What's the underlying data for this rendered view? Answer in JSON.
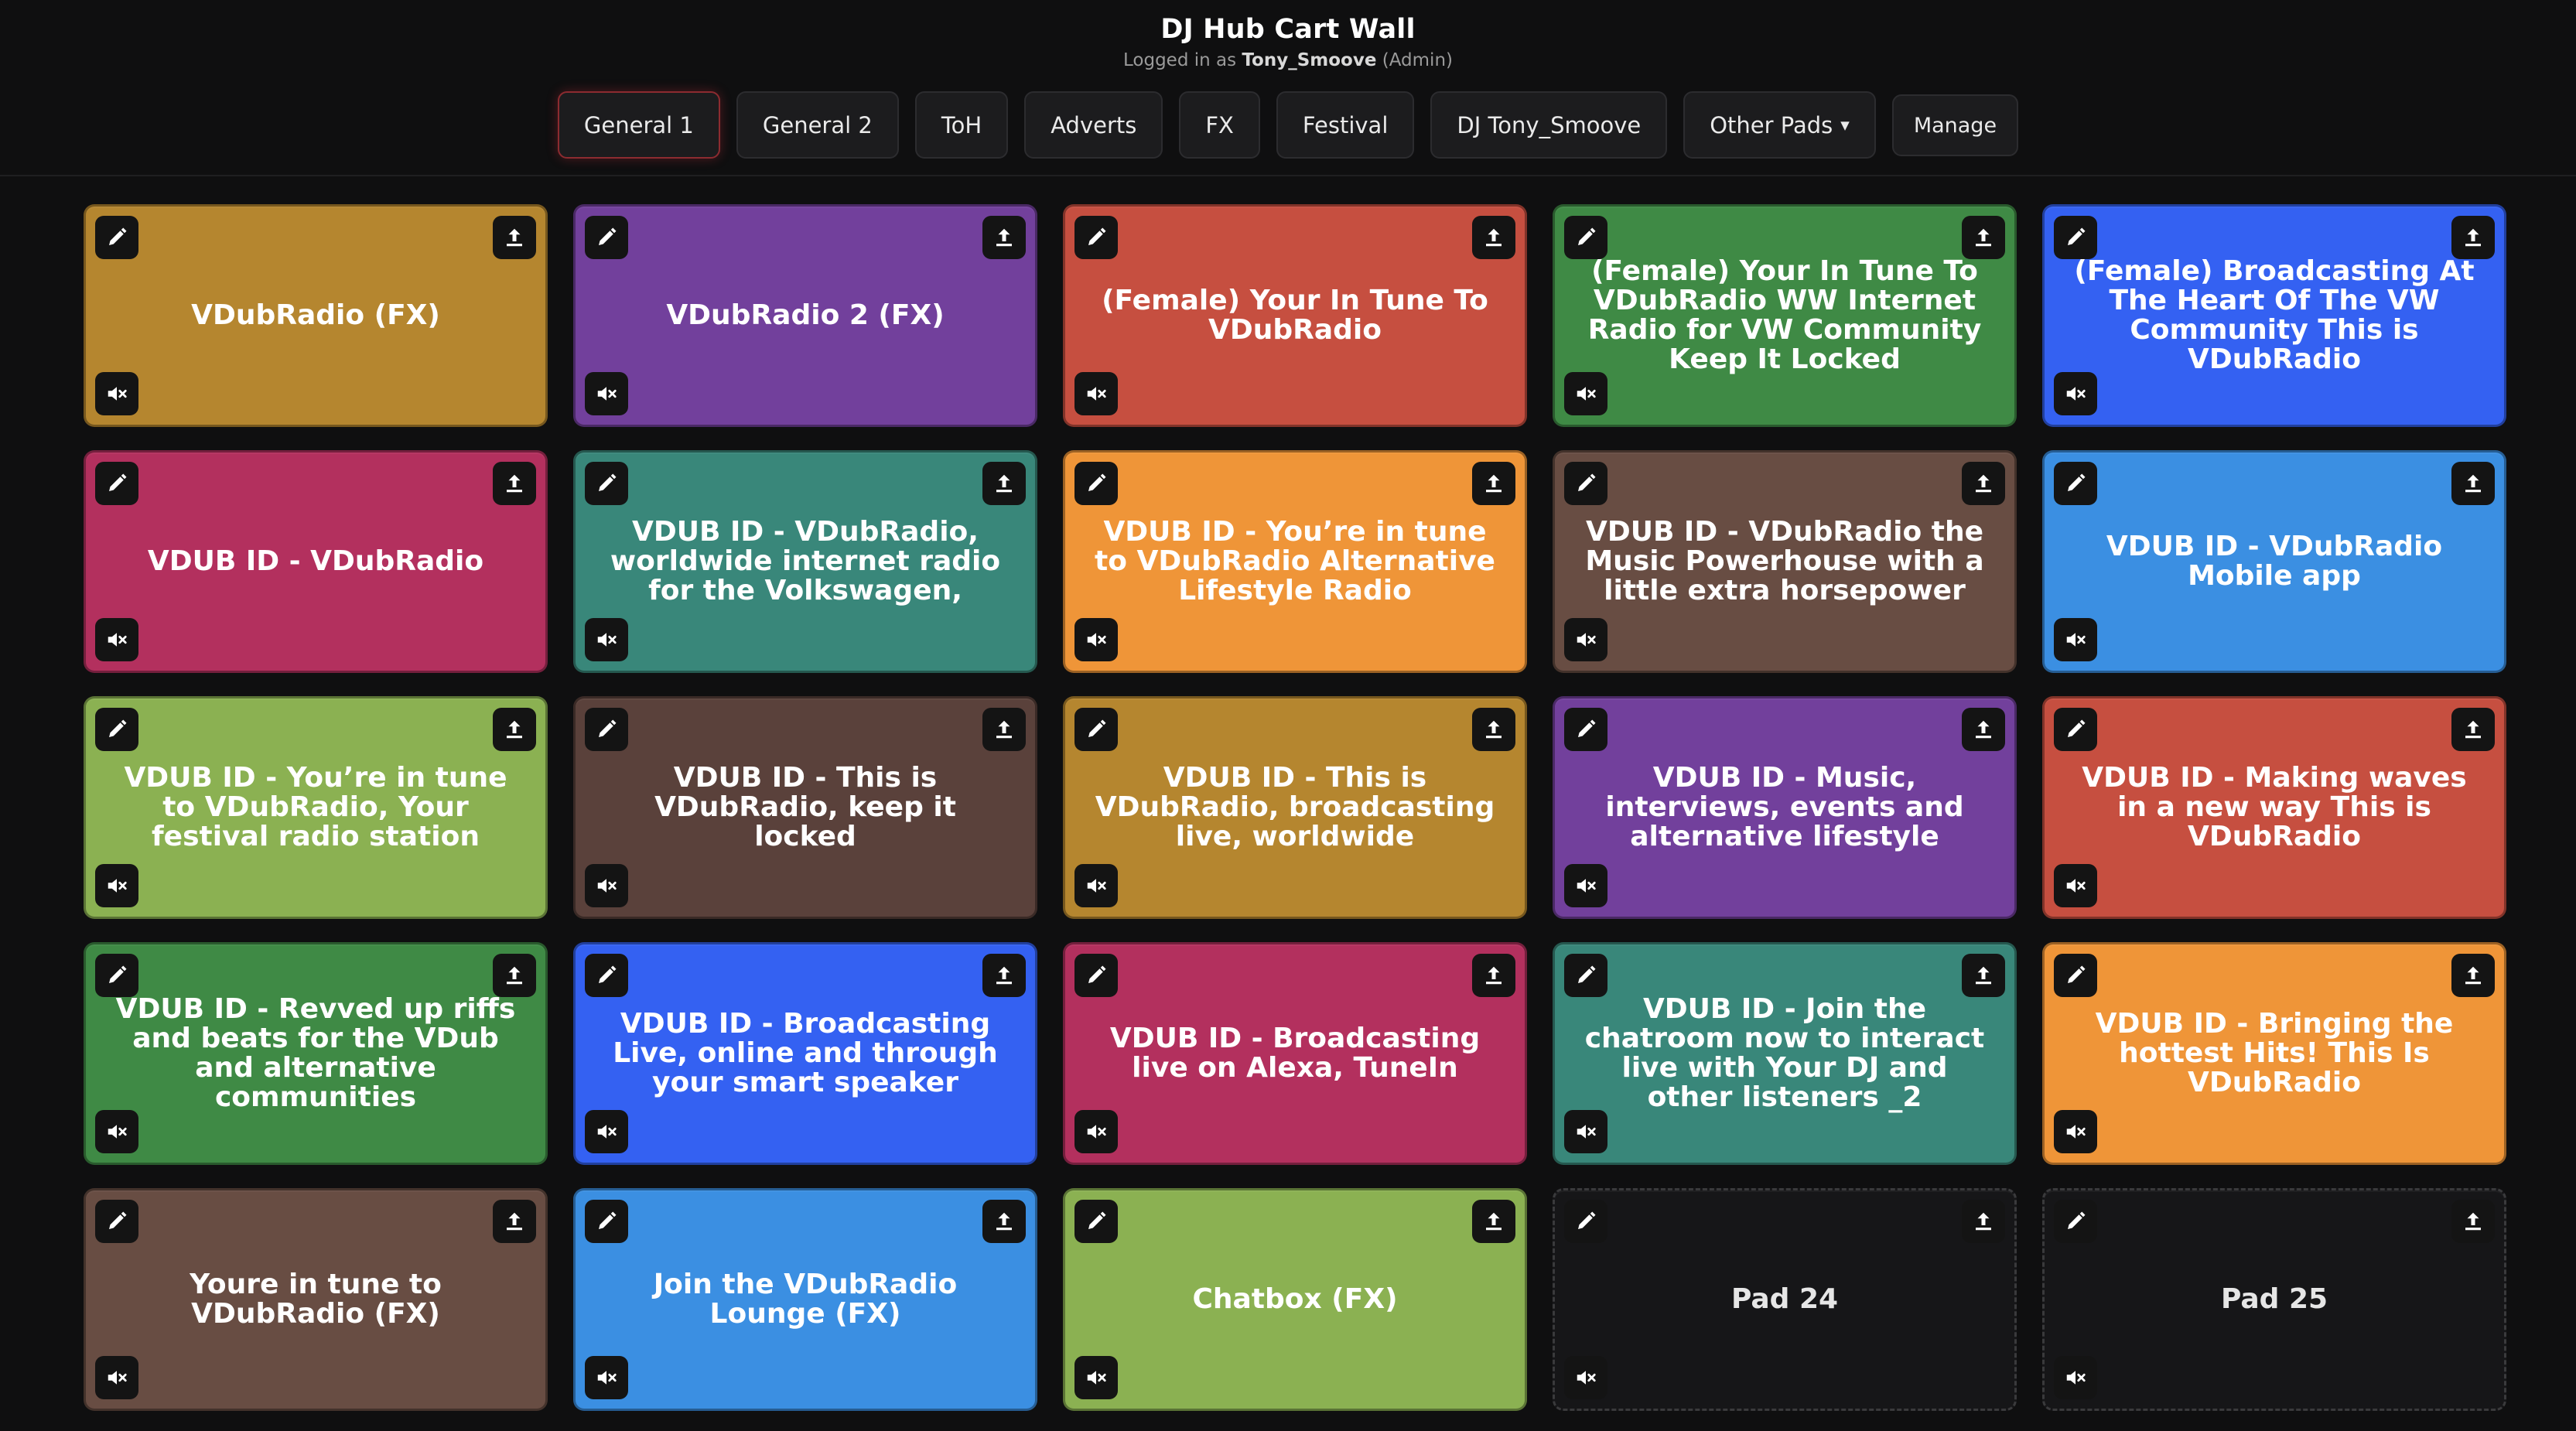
{
  "header": {
    "title": "DJ Hub Cart Wall",
    "logged_in_prefix": "Logged in as",
    "user": "Tony_Smoove",
    "role": "(Admin)"
  },
  "tabs": [
    {
      "label": "General 1",
      "active": true
    },
    {
      "label": "General 2"
    },
    {
      "label": "ToH"
    },
    {
      "label": "Adverts"
    },
    {
      "label": "FX"
    },
    {
      "label": "Festival"
    },
    {
      "label": "DJ Tony_Smoove"
    },
    {
      "label": "Other Pads",
      "dropdown": true
    },
    {
      "label": "Manage"
    }
  ],
  "pads": [
    {
      "label": "VDubRadio (FX)",
      "color": "#b5862f"
    },
    {
      "label": "VDubRadio 2 (FX)",
      "color": "#72409c"
    },
    {
      "label": "(Female) Your In Tune To VDubRadio",
      "color": "#c64f40"
    },
    {
      "label": "(Female) Your In Tune To VDubRadio WW Internet Radio for VW Community Keep It Locked",
      "color": "#3f8a45"
    },
    {
      "label": "(Female) Broadcasting At The Heart Of The VW Community This is VDubRadio",
      "color": "#3461f2"
    },
    {
      "label": "VDUB ID - VDubRadio",
      "color": "#b3305e"
    },
    {
      "label": "VDUB ID - VDubRadio, worldwide internet radio for the Volkswagen,",
      "color": "#39877a"
    },
    {
      "label": "VDUB ID - You’re in tune to VDubRadio Alternative Lifestyle Radio",
      "color": "#ef9538"
    },
    {
      "label": "VDUB ID - VDubRadio the Music Powerhouse with a little extra horsepower",
      "color": "#684d43"
    },
    {
      "label": "VDUB ID - VDubRadio Mobile app",
      "color": "#3b8fe2"
    },
    {
      "label": "VDUB ID - You’re in tune to VDubRadio, Your festival radio station",
      "color": "#8bb152"
    },
    {
      "label": "VDUB ID - This is VDubRadio, keep it locked",
      "color": "#5a413b"
    },
    {
      "label": "VDUB ID - This is VDubRadio, broadcasting live, worldwide",
      "color": "#b5862f"
    },
    {
      "label": "VDUB ID - Music, interviews, events and alternative lifestyle",
      "color": "#72409c"
    },
    {
      "label": "VDUB ID - Making waves in a new way This is VDubRadio",
      "color": "#c64f40"
    },
    {
      "label": "VDUB ID - Revved up riffs and beats for the VDub and alternative communities",
      "color": "#3f8a45"
    },
    {
      "label": "VDUB ID - Broadcasting Live, online and through your smart speaker",
      "color": "#3461f2"
    },
    {
      "label": "VDUB ID - Broadcasting live on Alexa, TuneIn",
      "color": "#b3305e"
    },
    {
      "label": "VDUB ID - Join the chatroom now to interact live with Your DJ and other listeners _2",
      "color": "#39877a"
    },
    {
      "label": "VDUB ID - Bringing the hottest Hits! This Is VDubRadio",
      "color": "#ef9538"
    },
    {
      "label": "Youre in tune to VDubRadio (FX)",
      "color": "#684d43"
    },
    {
      "label": "Join the VDubRadio Lounge (FX)",
      "color": "#3b8fe2"
    },
    {
      "label": "Chatbox (FX)",
      "color": "#8bb152"
    },
    {
      "label": "Pad 24",
      "color": "#161618",
      "empty": true
    },
    {
      "label": "Pad 25",
      "color": "#161618",
      "empty": true
    }
  ],
  "icons": {
    "edit": "pencil-icon",
    "upload": "upload-icon",
    "mute": "mute-icon"
  }
}
